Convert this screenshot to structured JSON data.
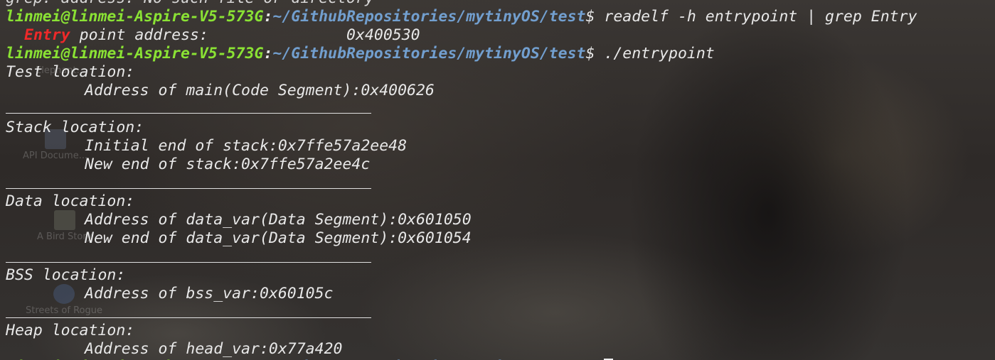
{
  "terminal": {
    "user_host": "linmei@linmei-Aspire-V5-573G",
    "colon": ":",
    "path": "~/GithubRepositories/mytinyOS/test",
    "dollar": "$ ",
    "lines": {
      "top_partial": "grep: address: No such file or directory",
      "cmd1": "readelf -h entrypoint | grep Entry",
      "out1_hit": "Entry",
      "out1_rest": " point address:               0x400530",
      "cmd2": "./entrypoint",
      "test_header": "Test location:",
      "test_main": "Address of main(Code Segment):0x400626",
      "stack_header": "Stack location:",
      "stack_initial": "Initial end of stack:0x7ffe57a2ee48",
      "stack_new": "New end of stack:0x7ffe57a2ee4c",
      "data_header": "Data location:",
      "data_addr": "Address of data_var(Data Segment):0x601050",
      "data_new": "New end of data_var(Data Segment):0x601054",
      "bss_header": "BSS location:",
      "bss_addr": "Address of bss_var:0x60105c",
      "heap_header": "Heap location:",
      "heap_addr": "Address of head_var:0x77a420"
    },
    "colors": {
      "prompt_user": "#8ae234",
      "prompt_path": "#729fcf",
      "grep_highlight": "#ef2929",
      "text": "#e8e8e8"
    }
  },
  "desktop_icons": [
    {
      "label": "Elephant..."
    },
    {
      "label": "API Docume..."
    },
    {
      "label": "A Bird Story"
    },
    {
      "label": "Streets of Rogue"
    }
  ]
}
